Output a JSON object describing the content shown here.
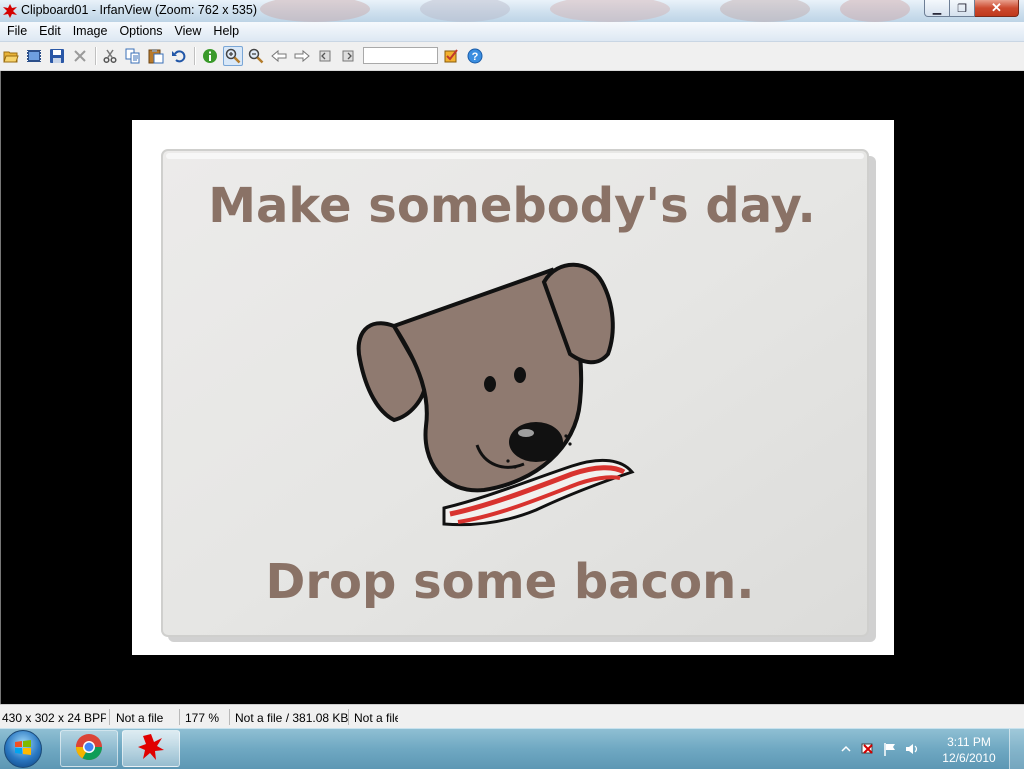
{
  "window": {
    "title": "Clipboard01 - IrfanView (Zoom: 762 x 535)",
    "minimize_glyph": "▁",
    "maximize_glyph": "❐",
    "close_glyph": "✕"
  },
  "menu": [
    "File",
    "Edit",
    "Image",
    "Options",
    "View",
    "Help"
  ],
  "toolbar": {
    "items": [
      "open-icon",
      "thumbnails-icon",
      "save-icon",
      "delete-icon",
      "cut-icon",
      "copy-icon",
      "paste-icon",
      "undo-icon",
      "info-icon",
      "zoom-in-icon",
      "zoom-out-icon",
      "previous-icon",
      "next-icon",
      "first-page-icon",
      "last-page-icon",
      "settings-icon",
      "help-icon"
    ],
    "search_value": ""
  },
  "image": {
    "headline": "Make somebody's day.",
    "footer": "Drop some bacon.",
    "text_color": "#8a7266",
    "dog_color": "#8f7a70",
    "background_color": "#e4e4e2"
  },
  "status": {
    "dimensions": "430 x 302 x 24 BPP",
    "file1": "Not a file",
    "zoom": "177 %",
    "file_size": "Not a file / 381.08 KB",
    "file2": "Not a file"
  },
  "taskbar": {
    "apps": [
      "chrome-icon",
      "irfanview-icon"
    ],
    "active_app": "irfanview-icon"
  },
  "clock": {
    "time": "3:11 PM",
    "date": "12/6/2010"
  },
  "colors": {
    "close_button": "#c0391c",
    "viewer_background": "#000000",
    "taskbar": "#6fa8c2"
  }
}
